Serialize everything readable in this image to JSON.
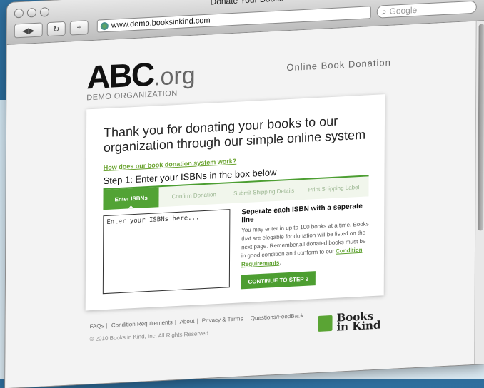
{
  "window": {
    "title": "Donate Your Books",
    "url": "www.demo.booksinkind.com",
    "search_placeholder": "Google",
    "nav": {
      "back": "◀",
      "forward": "▶",
      "reload": "↻",
      "add": "+"
    }
  },
  "header": {
    "logo_main": "ABC",
    "logo_ext": ".org",
    "logo_sub": "DEMO ORGANIZATION",
    "tagline": "Online Book Donation"
  },
  "card": {
    "headline": "Thank you for donating your books to our organization through our simple online system",
    "help_link": "How does our book donation system work?",
    "step_title": "Step 1: Enter your ISBNs in the box below",
    "tabs": [
      {
        "label": "Enter ISBNs",
        "active": true
      },
      {
        "label": "Confirm Donation",
        "active": false
      },
      {
        "label": "Submit Shipping Details",
        "active": false
      },
      {
        "label": "Print Shipping Label",
        "active": false
      }
    ],
    "isbn_placeholder": "Enter your ISBNs here...",
    "info_title": "Seperate each ISBN with a seperate line",
    "info_body": "You may enter in up to 100 books at a time. Books that are elegable for donation will be listed on the next page. Remember,all donated books must be in good condition and conform to our",
    "info_link": "Condition Requirements",
    "info_end": ".",
    "cta_label": "CONTINUE TO STEP 2"
  },
  "footer": {
    "links": [
      "FAQs",
      "Condition Requirements",
      "About",
      "Privacy & Terms",
      "Questions/FeedBack"
    ],
    "copyright": "© 2010 Books in Kind, Inc. All Rights Reserved",
    "brand_line1": "Books",
    "brand_line2": "in Kind"
  },
  "colors": {
    "accent": "#52a335",
    "backdrop": "#2f6f9e"
  }
}
